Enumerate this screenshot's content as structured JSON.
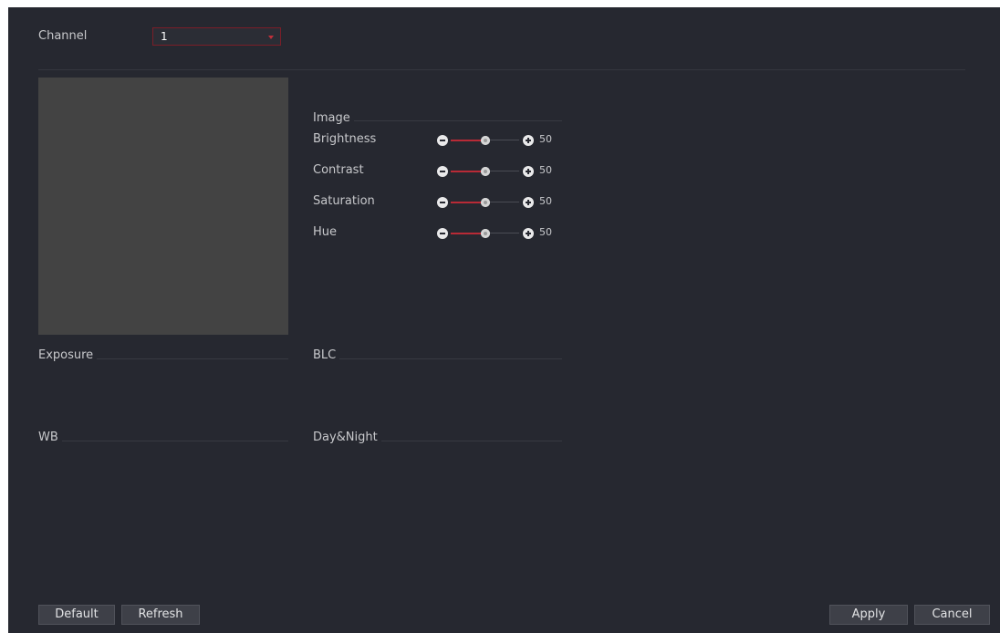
{
  "channel": {
    "label": "Channel",
    "value": "1"
  },
  "sections": {
    "image": "Image",
    "exposure": "Exposure",
    "blc": "BLC",
    "wb": "WB",
    "day_night": "Day&Night"
  },
  "sliders": [
    {
      "label": "Brightness",
      "value": "50",
      "level": 50
    },
    {
      "label": "Contrast",
      "value": "50",
      "level": 50
    },
    {
      "label": "Saturation",
      "value": "50",
      "level": 50
    },
    {
      "label": "Hue",
      "value": "50",
      "level": 50
    }
  ],
  "buttons": {
    "default": "Default",
    "refresh": "Refresh",
    "apply": "Apply",
    "cancel": "Cancel"
  },
  "colors": {
    "background": "#262830",
    "accent": "#b82a36",
    "text": "#c8c9cc",
    "preview": "#434343"
  }
}
